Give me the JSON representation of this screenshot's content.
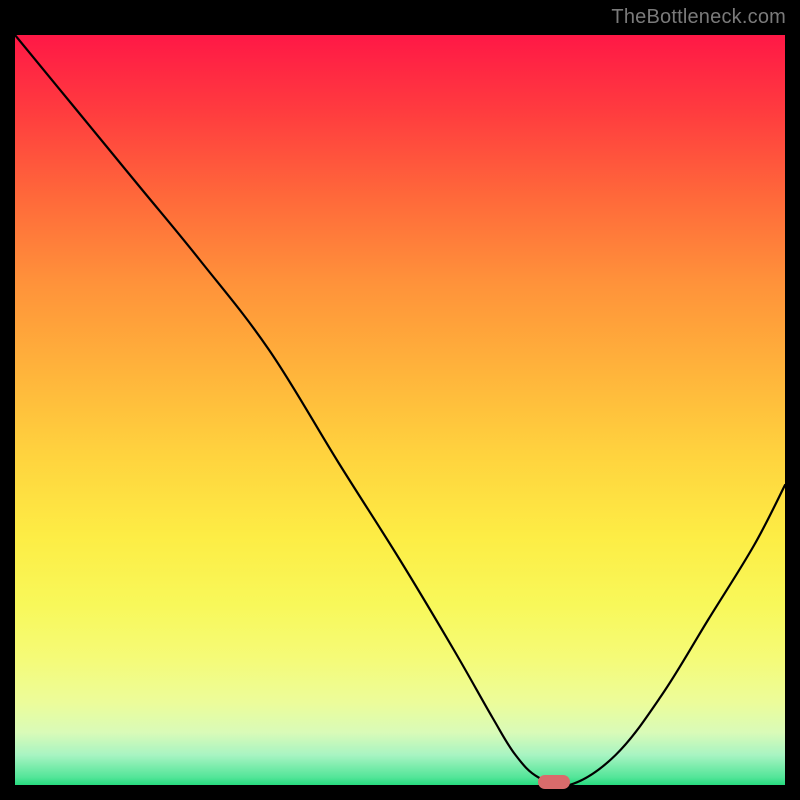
{
  "watermark": "TheBottleneck.com",
  "chart_data": {
    "type": "line",
    "title": "",
    "xlabel": "",
    "ylabel": "",
    "xlim": [
      0,
      100
    ],
    "ylim": [
      0,
      100
    ],
    "series": [
      {
        "name": "bottleneck-curve",
        "x": [
          0,
          8,
          16,
          24,
          33,
          42,
          50,
          57,
          62,
          65,
          68,
          72,
          78,
          84,
          90,
          96,
          100
        ],
        "values": [
          100,
          90,
          80,
          70,
          58,
          43,
          30,
          18,
          9,
          4,
          1,
          0,
          4,
          12,
          22,
          32,
          40
        ]
      }
    ],
    "marker": {
      "x": 70,
      "y": 0
    },
    "background_gradient": {
      "top": "#ff1846",
      "mid": "#ffd33e",
      "bottom": "#26da7e"
    }
  }
}
